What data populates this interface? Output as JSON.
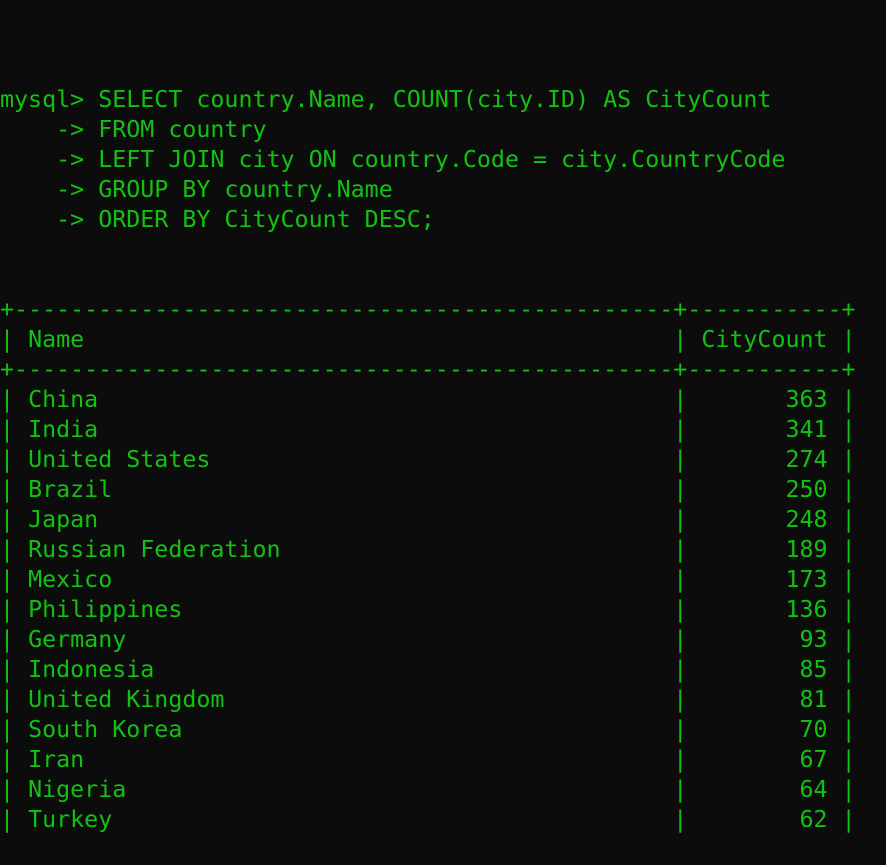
{
  "terminal": {
    "prompt": "mysql>",
    "continuation": "->",
    "query": [
      "SELECT country.Name, COUNT(city.ID) AS CityCount",
      "FROM country",
      "LEFT JOIN city ON country.Code = city.CountryCode",
      "GROUP BY country.Name",
      "ORDER BY CityCount DESC;"
    ],
    "colors": {
      "background": "#0c0c0c",
      "text": "#13c113"
    }
  },
  "result": {
    "columns": [
      "Name",
      "CityCount"
    ],
    "rows": [
      [
        "China",
        "363"
      ],
      [
        "India",
        "341"
      ],
      [
        "United States",
        "274"
      ],
      [
        "Brazil",
        "250"
      ],
      [
        "Japan",
        "248"
      ],
      [
        "Russian Federation",
        "189"
      ],
      [
        "Mexico",
        "173"
      ],
      [
        "Philippines",
        "136"
      ],
      [
        "Germany",
        "93"
      ],
      [
        "Indonesia",
        "85"
      ],
      [
        "United Kingdom",
        "81"
      ],
      [
        "South Korea",
        "70"
      ],
      [
        "Iran",
        "67"
      ],
      [
        "Nigeria",
        "64"
      ],
      [
        "Turkey",
        "62"
      ]
    ]
  }
}
